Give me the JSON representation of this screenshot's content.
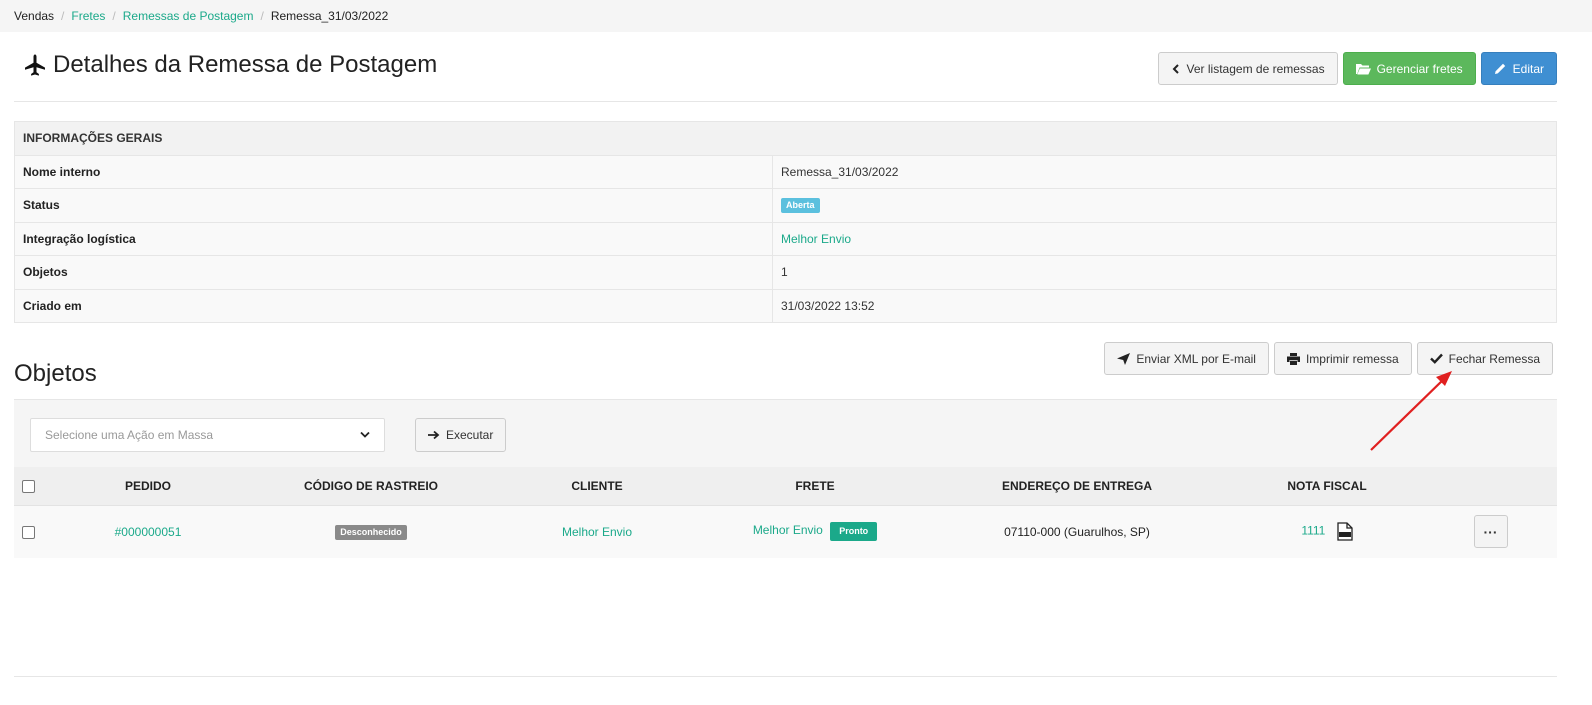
{
  "breadcrumb": {
    "items": [
      "Vendas",
      "Fretes",
      "Remessas de Postagem",
      "Remessa_31/03/2022"
    ]
  },
  "header": {
    "title": "Detalhes da Remessa de Postagem",
    "title_icon": "plane-icon",
    "buttons": {
      "list_label": "Ver listagem de remessas",
      "manage_label": "Gerenciar fretes",
      "edit_label": "Editar"
    }
  },
  "info": {
    "heading": "INFORMAÇÕES GERAIS",
    "rows": [
      {
        "label": "Nome interno",
        "value": "Remessa_31/03/2022"
      },
      {
        "label": "Status",
        "value": "Aberta"
      },
      {
        "label": "Integração logística",
        "value": "Melhor Envio"
      },
      {
        "label": "Objetos",
        "value": "1"
      },
      {
        "label": "Criado em",
        "value": "31/03/2022 13:52"
      }
    ]
  },
  "objects": {
    "title": "Objetos",
    "buttons": {
      "send_xml_label": "Enviar XML por E-mail",
      "print_label": "Imprimir remessa",
      "close_label": "Fechar Remessa"
    },
    "mass_action": {
      "placeholder": "Selecione uma Ação em Massa",
      "execute_label": "Executar"
    },
    "columns": [
      "PEDIDO",
      "CÓDIGO DE RASTREIO",
      "CLIENTE",
      "FRETE",
      "ENDEREÇO DE ENTREGA",
      "NOTA FISCAL"
    ],
    "rows": [
      {
        "order": "#000000051",
        "tracking": "Desconhecido",
        "client": "Melhor Envio",
        "shipping": "Melhor Envio",
        "shipping_status": "Pronto",
        "address": "07110-000 (Guarulhos, SP)",
        "invoice": "1111",
        "more_label": "···"
      }
    ]
  },
  "colors": {
    "link": "#1ba98a",
    "success": "#5cb85c",
    "primary": "#3f8fd2",
    "status_info": "#5bc0de",
    "annotation_arrow": "#e02020"
  }
}
